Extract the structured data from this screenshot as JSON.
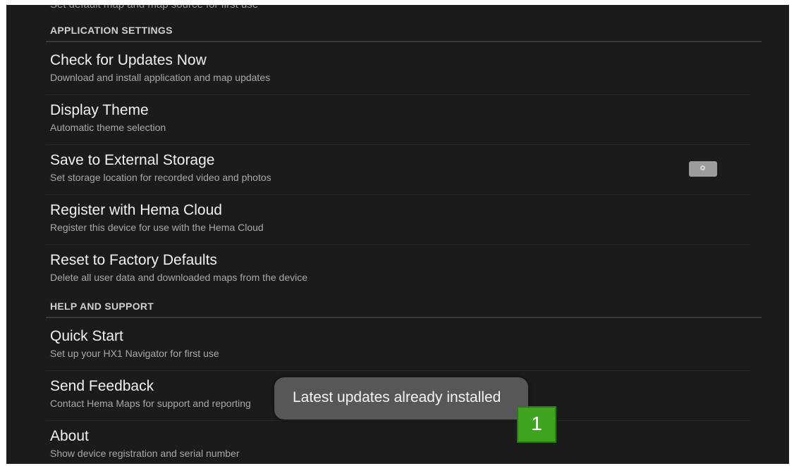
{
  "top_cut_text": "Set default map and map source for first use",
  "sections": [
    {
      "header": "APPLICATION SETTINGS",
      "items": [
        {
          "title": "Check for Updates Now",
          "summary": "Download and install application and map updates"
        },
        {
          "title": "Display Theme",
          "summary": "Automatic theme selection"
        },
        {
          "title": "Save to External Storage",
          "summary": "Set storage location for recorded video and photos"
        },
        {
          "title": "Register with Hema Cloud",
          "summary": "Register this device for use with the Hema Cloud"
        },
        {
          "title": "Reset to Factory Defaults",
          "summary": "Delete all user data and downloaded maps from the device"
        }
      ]
    },
    {
      "header": "HELP AND SUPPORT",
      "items": [
        {
          "title": "Quick Start",
          "summary": "Set up your HX1 Navigator for first use"
        },
        {
          "title": "Send Feedback",
          "summary": "Contact Hema Maps for support and reporting"
        },
        {
          "title": "About",
          "summary": "Show device registration and serial number"
        }
      ]
    }
  ],
  "toast": {
    "message": "Latest updates already installed"
  },
  "callout": {
    "label": "1",
    "color": "#3fa41f"
  },
  "icons": {
    "storage_setting": "camera-icon"
  }
}
